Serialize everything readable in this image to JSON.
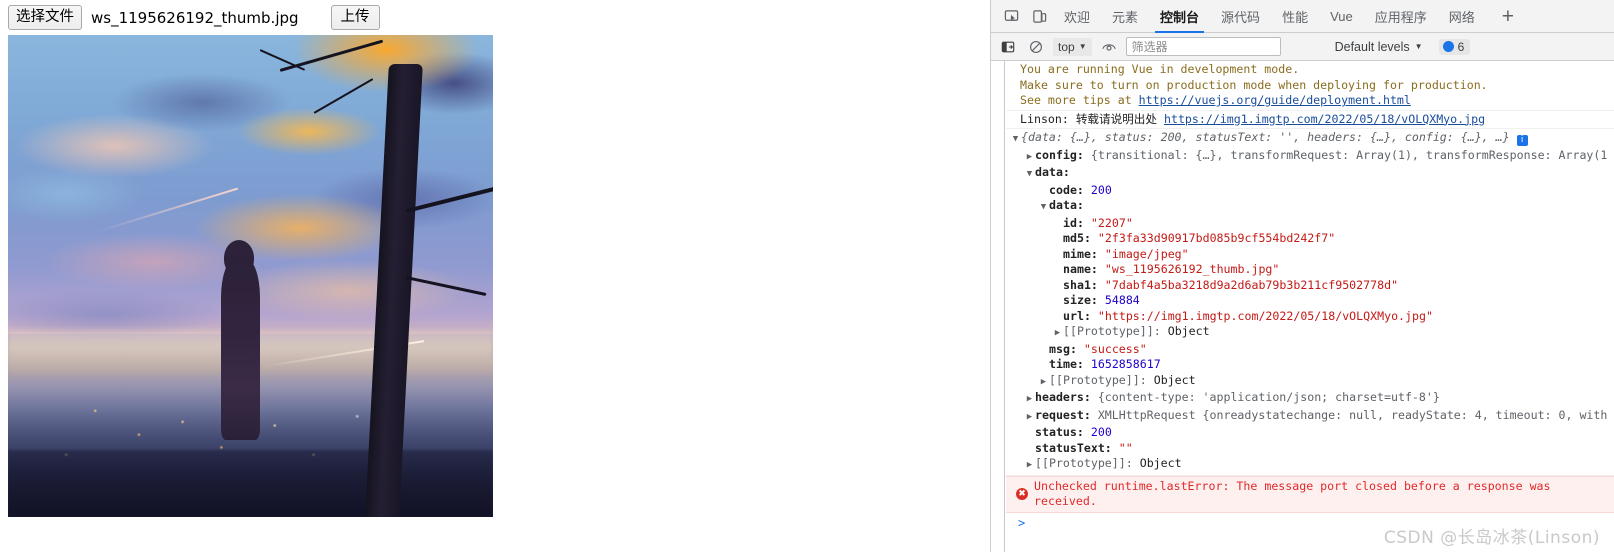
{
  "page": {
    "upload": {
      "choose_file_label": "选择文件",
      "file_name": "ws_1195626192_thumb.jpg",
      "upload_label": "上传"
    },
    "preview_alt": "ws_1195626192_thumb.jpg"
  },
  "devtools": {
    "tabs": [
      {
        "label": "欢迎",
        "active": false
      },
      {
        "label": "元素",
        "active": false
      },
      {
        "label": "控制台",
        "active": true
      },
      {
        "label": "源代码",
        "active": false
      },
      {
        "label": "性能",
        "active": false
      },
      {
        "label": "Vue",
        "active": false
      },
      {
        "label": "应用程序",
        "active": false
      },
      {
        "label": "网络",
        "active": false
      }
    ],
    "add_tab_label": "+",
    "toolbar": {
      "context_value": "top",
      "filter_placeholder": "筛选器",
      "filter_value": "",
      "levels_label": "Default levels",
      "issues_count": "6"
    },
    "console": {
      "messages": [
        {
          "type": "warning",
          "lines": [
            "You are running Vue in development mode.",
            "Make sure to turn on production mode when deploying for production.",
            "See more tips at "
          ],
          "link": "https://vuejs.org/guide/deployment.html"
        },
        {
          "type": "log",
          "text": "Linson: 转载请说明出处 ",
          "link": "https://img1.imgtp.com/2022/05/18/vOLQXMyo.jpg"
        }
      ],
      "object_tree": {
        "summary": "{data: {…}, status: 200, statusText: '', headers: {…}, config: {…}, …}",
        "rows": [
          {
            "indent": 1,
            "arrow": "closed",
            "key": "config",
            "sep": ":",
            "value": "{transitional: {…}, transformRequest: Array(1), transformResponse: Array(1"
          },
          {
            "indent": 1,
            "arrow": "open",
            "key": "data",
            "sep": ":",
            "value": ""
          },
          {
            "indent": 2,
            "arrow": "none",
            "key": "code",
            "sep": ":",
            "value": "200",
            "vtype": "num"
          },
          {
            "indent": 2,
            "arrow": "open",
            "key": "data",
            "sep": ":",
            "value": ""
          },
          {
            "indent": 3,
            "arrow": "none",
            "key": "id",
            "sep": ":",
            "value": "\"2207\"",
            "vtype": "str"
          },
          {
            "indent": 3,
            "arrow": "none",
            "key": "md5",
            "sep": ":",
            "value": "\"2f3fa33d90917bd085b9cf554bd242f7\"",
            "vtype": "str"
          },
          {
            "indent": 3,
            "arrow": "none",
            "key": "mime",
            "sep": ":",
            "value": "\"image/jpeg\"",
            "vtype": "str"
          },
          {
            "indent": 3,
            "arrow": "none",
            "key": "name",
            "sep": ":",
            "value": "\"ws_1195626192_thumb.jpg\"",
            "vtype": "str"
          },
          {
            "indent": 3,
            "arrow": "none",
            "key": "sha1",
            "sep": ":",
            "value": "\"7dabf4a5ba3218d9a2d6ab79b3b211cf9502778d\"",
            "vtype": "str"
          },
          {
            "indent": 3,
            "arrow": "none",
            "key": "size",
            "sep": ":",
            "value": "54884",
            "vtype": "num"
          },
          {
            "indent": 3,
            "arrow": "none",
            "key": "url",
            "sep": ":",
            "value": "\"https://img1.imgtp.com/2022/05/18/vOLQXMyo.jpg\"",
            "vtype": "str"
          },
          {
            "indent": 3,
            "arrow": "closed",
            "key": "[[Prototype]]",
            "sep": ":",
            "value": "Object",
            "vtype": "proto"
          },
          {
            "indent": 2,
            "arrow": "none",
            "key": "msg",
            "sep": ":",
            "value": "\"success\"",
            "vtype": "str"
          },
          {
            "indent": 2,
            "arrow": "none",
            "key": "time",
            "sep": ":",
            "value": "1652858617",
            "vtype": "num"
          },
          {
            "indent": 2,
            "arrow": "closed",
            "key": "[[Prototype]]",
            "sep": ":",
            "value": "Object",
            "vtype": "proto"
          },
          {
            "indent": 1,
            "arrow": "closed",
            "key": "headers",
            "sep": ":",
            "value": "{content-type: 'application/json; charset=utf-8'}"
          },
          {
            "indent": 1,
            "arrow": "closed",
            "key": "request",
            "sep": ":",
            "value": "XMLHttpRequest {onreadystatechange: null, readyState: 4, timeout: 0, with"
          },
          {
            "indent": 1,
            "arrow": "none",
            "key": "status",
            "sep": ":",
            "value": "200",
            "vtype": "num"
          },
          {
            "indent": 1,
            "arrow": "none",
            "key": "statusText",
            "sep": ":",
            "value": "\"\"",
            "vtype": "str"
          },
          {
            "indent": 1,
            "arrow": "closed",
            "key": "[[Prototype]]",
            "sep": ":",
            "value": "Object",
            "vtype": "proto"
          }
        ]
      },
      "error": {
        "text": "Unchecked runtime.lastError: The message port closed before a response was received."
      },
      "prompt_symbol": ">"
    }
  },
  "watermark": "CSDN @长岛冰茶(Linson)",
  "colors": {
    "accent": "#1a73e8",
    "error": "#e02a2a",
    "warning_text": "#8a6d1f",
    "link": "#1a4d9c",
    "string": "#c41a16",
    "number": "#1c00cf"
  }
}
